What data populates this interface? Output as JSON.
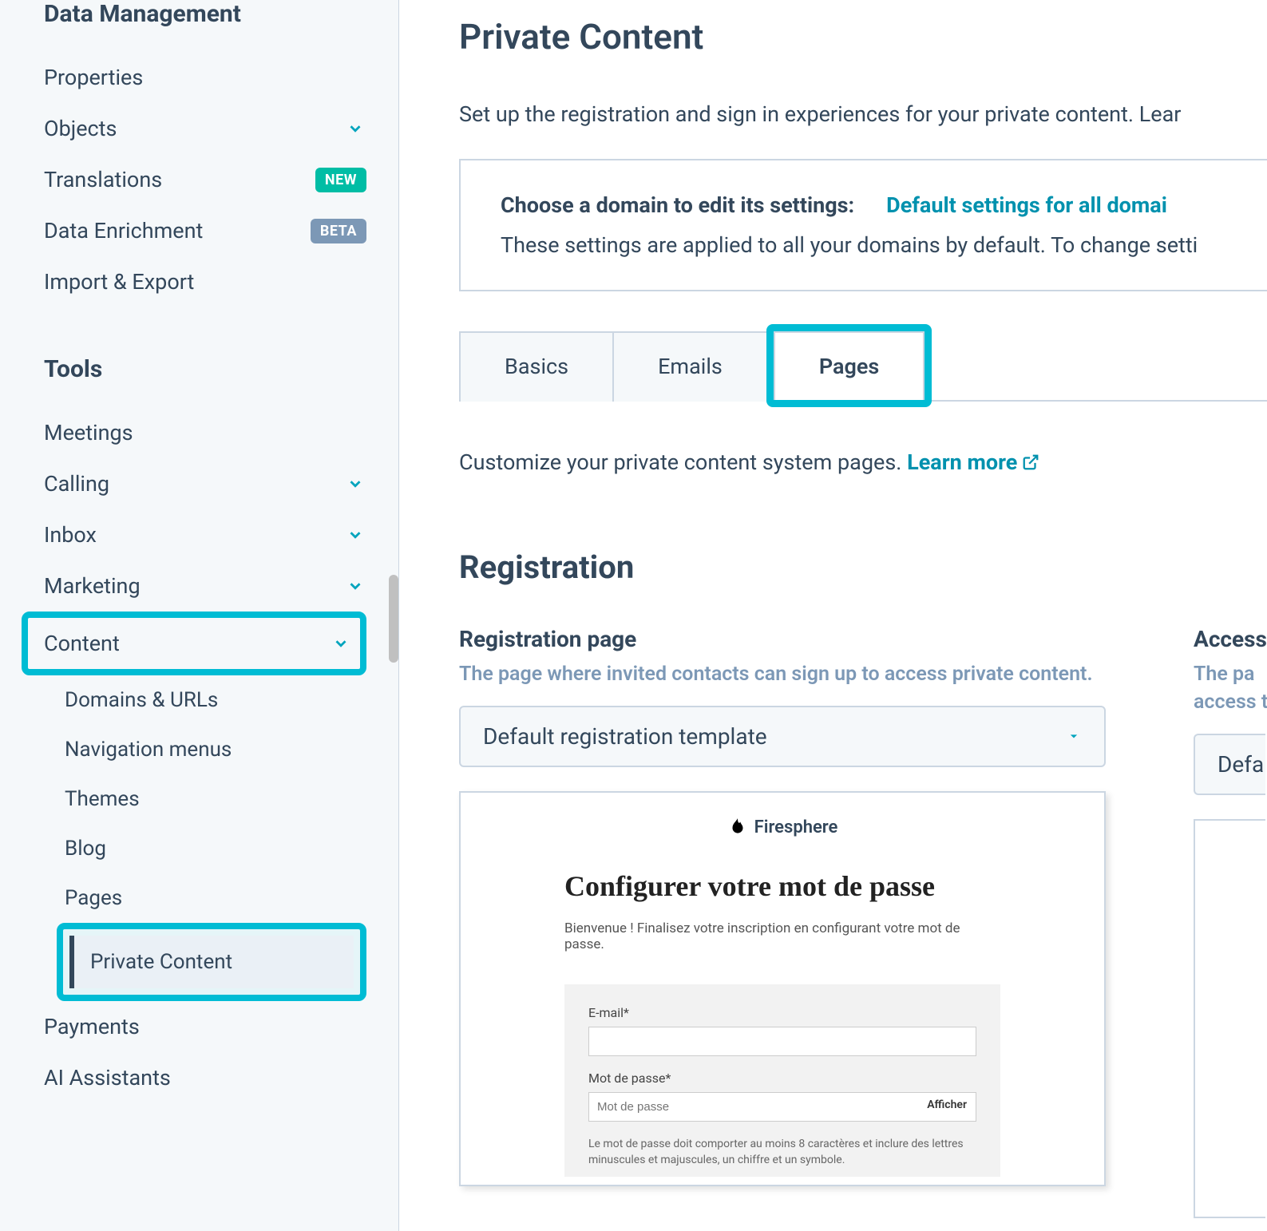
{
  "sidebar": {
    "groups": [
      {
        "title": "Data Management",
        "items": [
          {
            "label": "Properties"
          },
          {
            "label": "Objects",
            "chevron": true
          },
          {
            "label": "Translations",
            "badge": "NEW",
            "badgeClass": "new"
          },
          {
            "label": "Data Enrichment",
            "badge": "BETA",
            "badgeClass": "beta"
          },
          {
            "label": "Import & Export"
          }
        ]
      },
      {
        "title": "Tools",
        "items": [
          {
            "label": "Meetings"
          },
          {
            "label": "Calling",
            "chevron": true
          },
          {
            "label": "Inbox",
            "chevron": true
          },
          {
            "label": "Marketing",
            "chevron": true
          },
          {
            "label": "Content",
            "chevron": true,
            "highlighted": true,
            "sub": [
              {
                "label": "Domains & URLs"
              },
              {
                "label": "Navigation menus"
              },
              {
                "label": "Themes"
              },
              {
                "label": "Blog"
              },
              {
                "label": "Pages"
              },
              {
                "label": "Private Content",
                "active": true
              }
            ]
          },
          {
            "label": "Payments"
          },
          {
            "label": "AI Assistants"
          }
        ]
      }
    ]
  },
  "main": {
    "title": "Private Content",
    "desc": "Set up the registration and sign in experiences for your private content. Lear",
    "domainBox": {
      "label": "Choose a domain to edit its settings:",
      "link": "Default settings for all domai",
      "desc": "These settings are applied to all your domains by default. To change setti"
    },
    "tabs": [
      "Basics",
      "Emails",
      "Pages"
    ],
    "activeTab": 2,
    "customize": "Customize your private content system pages. ",
    "learnMore": "Learn more",
    "section": "Registration",
    "reg": {
      "title": "Registration page",
      "desc": "The page where invited contacts can sign up to access private content.",
      "select": "Default registration template"
    },
    "access": {
      "title": "Access",
      "desc1": "The pa",
      "desc2": "access t",
      "select": "Defa"
    },
    "preview": {
      "brand": "Firesphere",
      "heading": "Configurer votre mot de passe",
      "welcome": "Bienvenue ! Finalisez votre inscription en configurant votre mot de passe.",
      "emailLabel": "E-mail*",
      "pwLabel": "Mot de passe*",
      "pwPlaceholder": "Mot de passe",
      "show": "Afficher",
      "hint": "Le mot de passe doit comporter au moins 8 caractères et inclure des lettres minuscules et majuscules, un chiffre et un symbole."
    }
  }
}
